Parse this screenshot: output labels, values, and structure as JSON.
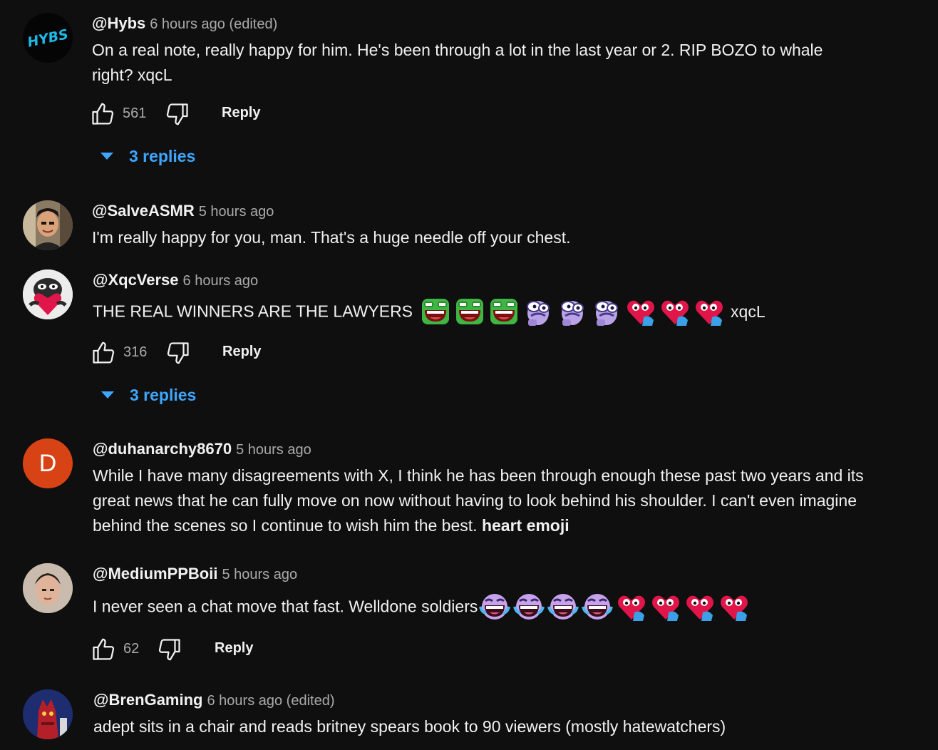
{
  "comments": [
    {
      "handle": "@Hybs",
      "time": "6 hours ago (edited)",
      "avatar_text": "HYBS",
      "text": "On a real note, really happy for him. He's been through a lot in the last year or 2. RIP BOZO to whale right? xqcL",
      "likes": "561",
      "reply_label": "Reply",
      "replies_label": "3 replies"
    },
    {
      "handle": "@SalveASMR",
      "time": "5 hours ago",
      "text": "I'm really happy for you, man. That's a huge needle off your chest."
    },
    {
      "handle": "@XqcVerse",
      "time": "6 hours ago",
      "text": "THE REAL WINNERS ARE THE LAWYERS",
      "text_after": "xqcL",
      "likes": "316",
      "reply_label": "Reply",
      "replies_label": "3 replies"
    },
    {
      "handle": "@duhanarchy8670",
      "time": "5 hours ago",
      "avatar_letter": "D",
      "text": "While I have many disagreements with X, I think he has been through enough these past two years and its great news that he can fully move on now without having to look behind his shoulder. I  can't even imagine behind the scenes so I continue to wish him the best.",
      "text_bold": "heart emoji"
    },
    {
      "handle": "@MediumPPBoii",
      "time": "5 hours ago",
      "text": "I never seen a chat move that fast. Welldone soldiers",
      "likes": "62",
      "reply_label": "Reply"
    },
    {
      "handle": "@BrenGaming",
      "time": "6 hours ago (edited)",
      "text": "adept sits in a chair and reads britney spears book to 90 viewers (mostly hatewatchers)"
    }
  ],
  "colors": {
    "background": "#0f0f0f",
    "text_primary": "#f1f1f1",
    "text_secondary": "#aaaaaa",
    "link_blue": "#3ea6ff",
    "duhan_avatar": "#d84315"
  },
  "icons": [
    "like-icon",
    "dislike-icon",
    "chevron-down-icon",
    "pepe-laugh-emote",
    "purple-cry-emote",
    "heart-hug-emote",
    "purple-laugh-emote"
  ]
}
